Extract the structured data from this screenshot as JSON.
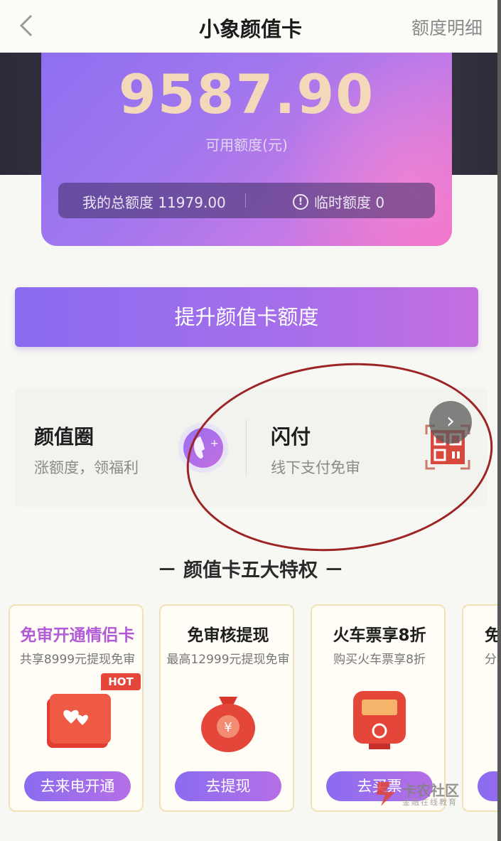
{
  "nav": {
    "title": "小象颜值卡",
    "detail_link": "额度明细"
  },
  "card": {
    "available_amount": "9587.90",
    "available_label": "可用额度(元)",
    "total_label": "我的总额度 11979.00",
    "temp_label": "临时额度 0"
  },
  "primary_button": "提升颜值卡额度",
  "features": [
    {
      "title": "颜值圈",
      "subtitle": "涨额度，领福利"
    },
    {
      "title": "闪付",
      "subtitle": "线下支付免审"
    }
  ],
  "section_title": "－ 颜值卡五大特权 －",
  "privileges": [
    {
      "title": "免审开通情侣卡",
      "subtitle": "共享8999元提现免审",
      "button": "去来电开通",
      "badge": "HOT"
    },
    {
      "title": "免审核提现",
      "subtitle": "最高12999元提现免审",
      "button": "去提现"
    },
    {
      "title": "火车票享8折",
      "subtitle": "购买火车票享8折",
      "button": "去买票"
    },
    {
      "title": "免",
      "subtitle": "分期",
      "button": ""
    }
  ],
  "watermark": {
    "text": "卡农社区",
    "sub": "金融在线教育"
  },
  "colors": {
    "accent_purple": "#8a6cf0",
    "accent_pink": "#ee6fc7",
    "amount_gold": "#f3d9ba",
    "highlight_circle": "#9c2424",
    "hot_red": "#e6463a"
  },
  "icons": {
    "back": "chevron-left-icon",
    "warning": "info-circle-icon",
    "circle_feature": "face-circle-icon",
    "pay_feature": "qr-code-icon",
    "arrow": "chevron-right-icon"
  }
}
